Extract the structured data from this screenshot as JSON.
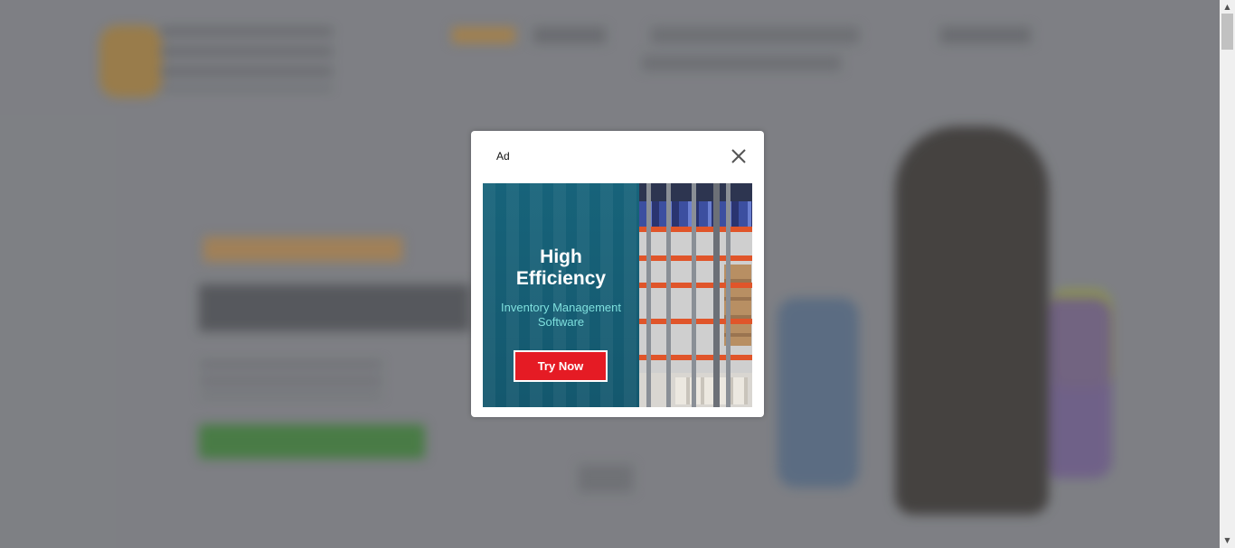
{
  "modal": {
    "label": "Ad",
    "close_icon": "close-icon"
  },
  "ad": {
    "headline_line1": "High",
    "headline_line2": "Efficiency",
    "subtitle_line1": "Inventory Management",
    "subtitle_line2": "Software",
    "cta_label": "Try Now",
    "colors": {
      "panel": "#17637a",
      "subtitle": "#7fe0de",
      "cta": "#e51b24"
    }
  },
  "scrollbar": {
    "up_icon": "scroll-up-arrow-icon",
    "down_icon": "scroll-down-arrow-icon"
  }
}
